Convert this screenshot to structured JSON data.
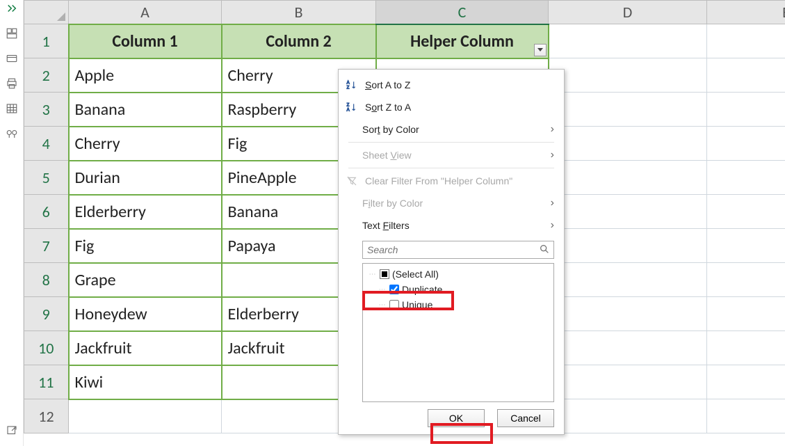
{
  "side_icons": [
    "expand",
    "dashboard",
    "card",
    "printer",
    "grid",
    "binoculars",
    "share"
  ],
  "columns": [
    "A",
    "B",
    "C",
    "D",
    "E"
  ],
  "rows": [
    "1",
    "2",
    "3",
    "4",
    "5",
    "6",
    "7",
    "8",
    "9",
    "10",
    "11",
    "12"
  ],
  "headers": {
    "a": "Column 1",
    "b": "Column 2",
    "c": "Helper Column"
  },
  "dataA": [
    "Apple",
    "Banana",
    "Cherry",
    "Durian",
    "Elderberry",
    "Fig",
    "Grape",
    "Honeydew",
    "Jackfruit",
    "Kiwi"
  ],
  "dataB": [
    "Cherry",
    "Raspberry",
    "Fig",
    "PineApple",
    "Banana",
    "Papaya",
    "",
    "Elderberry",
    "Jackfruit",
    ""
  ],
  "menu": {
    "sort_az": "Sort A to Z",
    "sort_za": "Sort Z to A",
    "sort_color": "Sort by Color",
    "sheet_view": "Sheet View",
    "clear_filter": "Clear Filter From \"Helper Column\"",
    "filter_color": "Filter by Color",
    "text_filters": "Text Filters",
    "search_placeholder": "Search",
    "items": {
      "select_all": "(Select All)",
      "duplicate": "Duplicate",
      "unique": "Unique"
    },
    "ok": "OK",
    "cancel": "Cancel"
  }
}
